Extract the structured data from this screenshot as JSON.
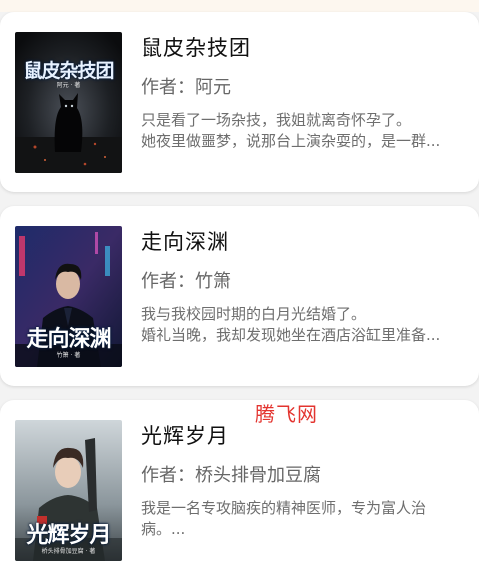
{
  "books": [
    {
      "title": "鼠皮杂技团",
      "author_label": "作者：",
      "author": "阿元",
      "desc_line1": "只是看了一场杂技，我姐就离奇怀孕了。",
      "desc_line2": "她夜里做噩梦，说那台上演杂耍的，是一群...",
      "cover_title": "鼠皮杂技团",
      "cover_author": "阿元 · 著",
      "cover_icon": "dark-cat-cover-art"
    },
    {
      "title": "走向深渊",
      "author_label": "作者：",
      "author": "竹箫",
      "desc_line1": "我与我校园时期的白月光结婚了。",
      "desc_line2": "婚礼当晚，我却发现她坐在酒店浴缸里准备...",
      "cover_title": "走向深渊",
      "cover_author": "竹箫 · 著",
      "cover_icon": "man-in-suit-cover-art"
    },
    {
      "title": "光辉岁月",
      "author_label": "作者：",
      "author": "桥头排骨加豆腐",
      "desc_line1": "我是一名专攻脑疾的精神医师，专为富人治",
      "desc_line2": "病。...",
      "cover_title": "光辉岁月",
      "cover_author": "桥头排骨加豆腐 · 著",
      "cover_icon": "soldier-cover-art"
    }
  ],
  "watermark": "腾飞网",
  "colors": {
    "title": "#111111",
    "meta": "#666666",
    "watermark": "#e3342f"
  }
}
